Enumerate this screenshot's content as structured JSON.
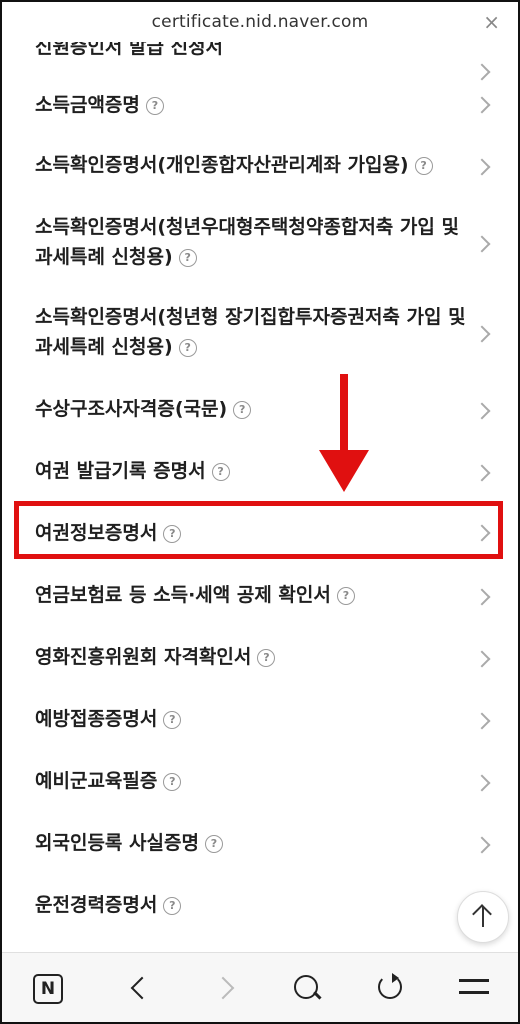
{
  "browser": {
    "url": "certificate.nid.naver.com",
    "close_glyph": "×"
  },
  "list": {
    "items": [
      {
        "label": "신원증인서 발급 신청서",
        "lines": 1
      },
      {
        "label": "소득금액증명",
        "lines": 1
      },
      {
        "label": "소득확인증명서(개인종합자산관리계좌 가입용)",
        "lines": 1
      },
      {
        "label": "소득확인증명서(청년우대형주택청약종합저축 가입 및",
        "label2": "과세특례 신청용)",
        "lines": 2
      },
      {
        "label": "소득확인증명서(청년형 장기집합투자증권저축 가입 및",
        "label2": "과세특례 신청용)",
        "lines": 2
      },
      {
        "label": "수상구조사자격증(국문)",
        "lines": 1
      },
      {
        "label": "여권 발급기록 증명서",
        "lines": 1
      },
      {
        "label": "여권정보증명서",
        "lines": 1,
        "highlighted": true
      },
      {
        "label": "연금보험료 등 소득·세액 공제 확인서",
        "lines": 1
      },
      {
        "label": "영화진흥위원회 자격확인서",
        "lines": 1
      },
      {
        "label": "예방접종증명서",
        "lines": 1
      },
      {
        "label": "예비군교육필증",
        "lines": 1
      },
      {
        "label": "외국인등록 사실증명",
        "lines": 1
      },
      {
        "label": "운전경력증명서",
        "lines": 1
      }
    ]
  },
  "help_glyph": "?",
  "bottom_nav": {
    "home_label": "N"
  },
  "colors": {
    "highlight": "#e01010",
    "text": "#1f1f1f"
  }
}
